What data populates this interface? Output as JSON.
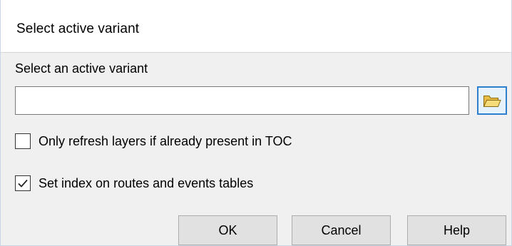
{
  "window": {
    "title": "Select active variant"
  },
  "form": {
    "prompt_label": "Select an active variant",
    "path_input": {
      "value": "",
      "placeholder": ""
    },
    "browse_icon": "folder-open-icon",
    "checkboxes": [
      {
        "label": "Only refresh layers if already present in TOC",
        "checked": false
      },
      {
        "label": "Set index on routes and events tables",
        "checked": true
      }
    ]
  },
  "buttons": {
    "ok_label": "OK",
    "cancel_label": "Cancel",
    "help_label": "Help"
  },
  "colors": {
    "dialog_background": "#f0f0f0",
    "title_background": "#ffffff",
    "focus_accent": "#2f7fd0",
    "folder_icon": "#f2d266"
  }
}
